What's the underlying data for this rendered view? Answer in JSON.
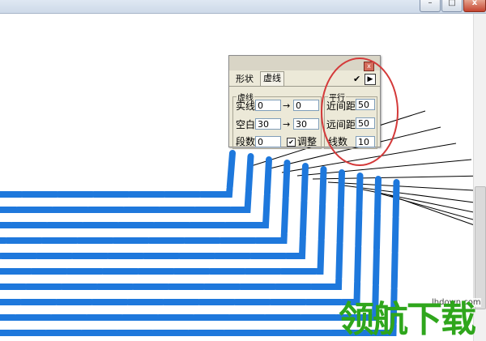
{
  "window": {
    "minimize_glyph": "–",
    "maximize_glyph": "□",
    "close_glyph": "x"
  },
  "panel": {
    "close_glyph": "x",
    "tabs": [
      {
        "label": "形状"
      },
      {
        "label": "虚线"
      }
    ],
    "apply_check_glyph": "✔",
    "play_icon": "play-icon",
    "play_glyph": "▶",
    "dash_group": {
      "title": "虚线",
      "solid_label": "实线",
      "solid_from": "0",
      "solid_to": "0",
      "gap_label": "空白",
      "gap_from": "30",
      "gap_to": "30",
      "count_label": "段数",
      "count_value": "0",
      "adjust_label": "调整",
      "adjust_checked": true
    },
    "parallel_group": {
      "title": "平行",
      "near_label": "近间距",
      "near_value": "50",
      "far_label": "远间距",
      "far_value": "50",
      "lines_label": "线数",
      "lines_value": "10"
    }
  },
  "colors": {
    "stroke_blue": "#1e78dc",
    "thin_line": "#000000",
    "highlight_red": "#d43a3a",
    "watermark_green": "#2fa61c"
  },
  "watermark": {
    "url": "lhdown.com",
    "text": "领航下载"
  }
}
